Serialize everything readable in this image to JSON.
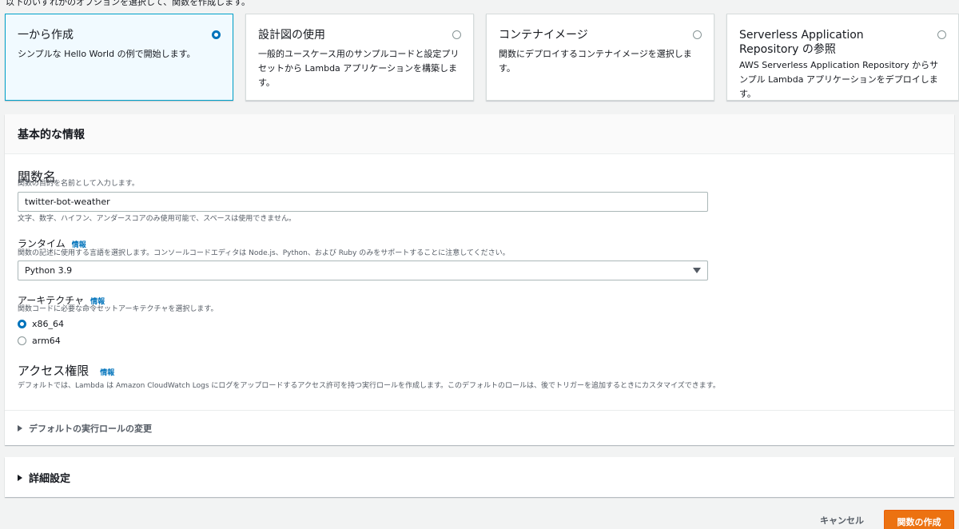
{
  "top_note": "以下のいずれかのオプションを選択して、関数を作成します。",
  "options": [
    {
      "title": "一から作成",
      "desc": "シンプルな Hello World の例で開始します。",
      "selected": true
    },
    {
      "title": "設計図の使用",
      "desc": "一般的ユースケース用のサンプルコードと設定プリセットから Lambda アプリケーションを構築します。",
      "selected": false
    },
    {
      "title": "コンテナイメージ",
      "desc": "関数にデプロイするコンテナイメージを選択します。",
      "selected": false
    },
    {
      "title": "Serverless Application Repository の参照",
      "desc": "AWS Serverless Application Repository からサンプル Lambda アプリケーションをデプロイします。",
      "selected": false
    }
  ],
  "basic_info": {
    "header": "基本的な情報",
    "function_name": {
      "label": "関数名",
      "hint": "関数の目的を名前として入力します。",
      "value": "twitter-bot-weather",
      "constraint": "文字、数字、ハイフン、アンダースコアのみ使用可能で、スペースは使用できません。"
    },
    "runtime": {
      "label": "ランタイム",
      "info": "情報",
      "hint": "関数の記述に使用する言語を選択します。コンソールコードエディタは Node.js、Python、および Ruby のみをサポートすることに注意してください。",
      "value": "Python 3.9"
    },
    "architecture": {
      "label": "アーキテクチャ",
      "info": "情報",
      "hint": "関数コードに必要な命令セットアーキテクチャを選択します。",
      "options": [
        "x86_64",
        "arm64"
      ]
    },
    "access": {
      "title": "アクセス権限",
      "info": "情報",
      "desc": "デフォルトでは、Lambda は Amazon CloudWatch Logs にログをアップロードするアクセス許可を持つ実行ロールを作成します。このデフォルトのロールは、後でトリガーを追加するときにカスタマイズできます。"
    },
    "role_expander": "デフォルトの実行ロールの変更"
  },
  "advanced": {
    "label": "詳細設定"
  },
  "footer": {
    "cancel": "キャンセル",
    "create": "関数の作成"
  },
  "colors": {
    "accent": "#0073bb",
    "primary_button": "#ec7211",
    "selected_border": "#00a1c9"
  }
}
